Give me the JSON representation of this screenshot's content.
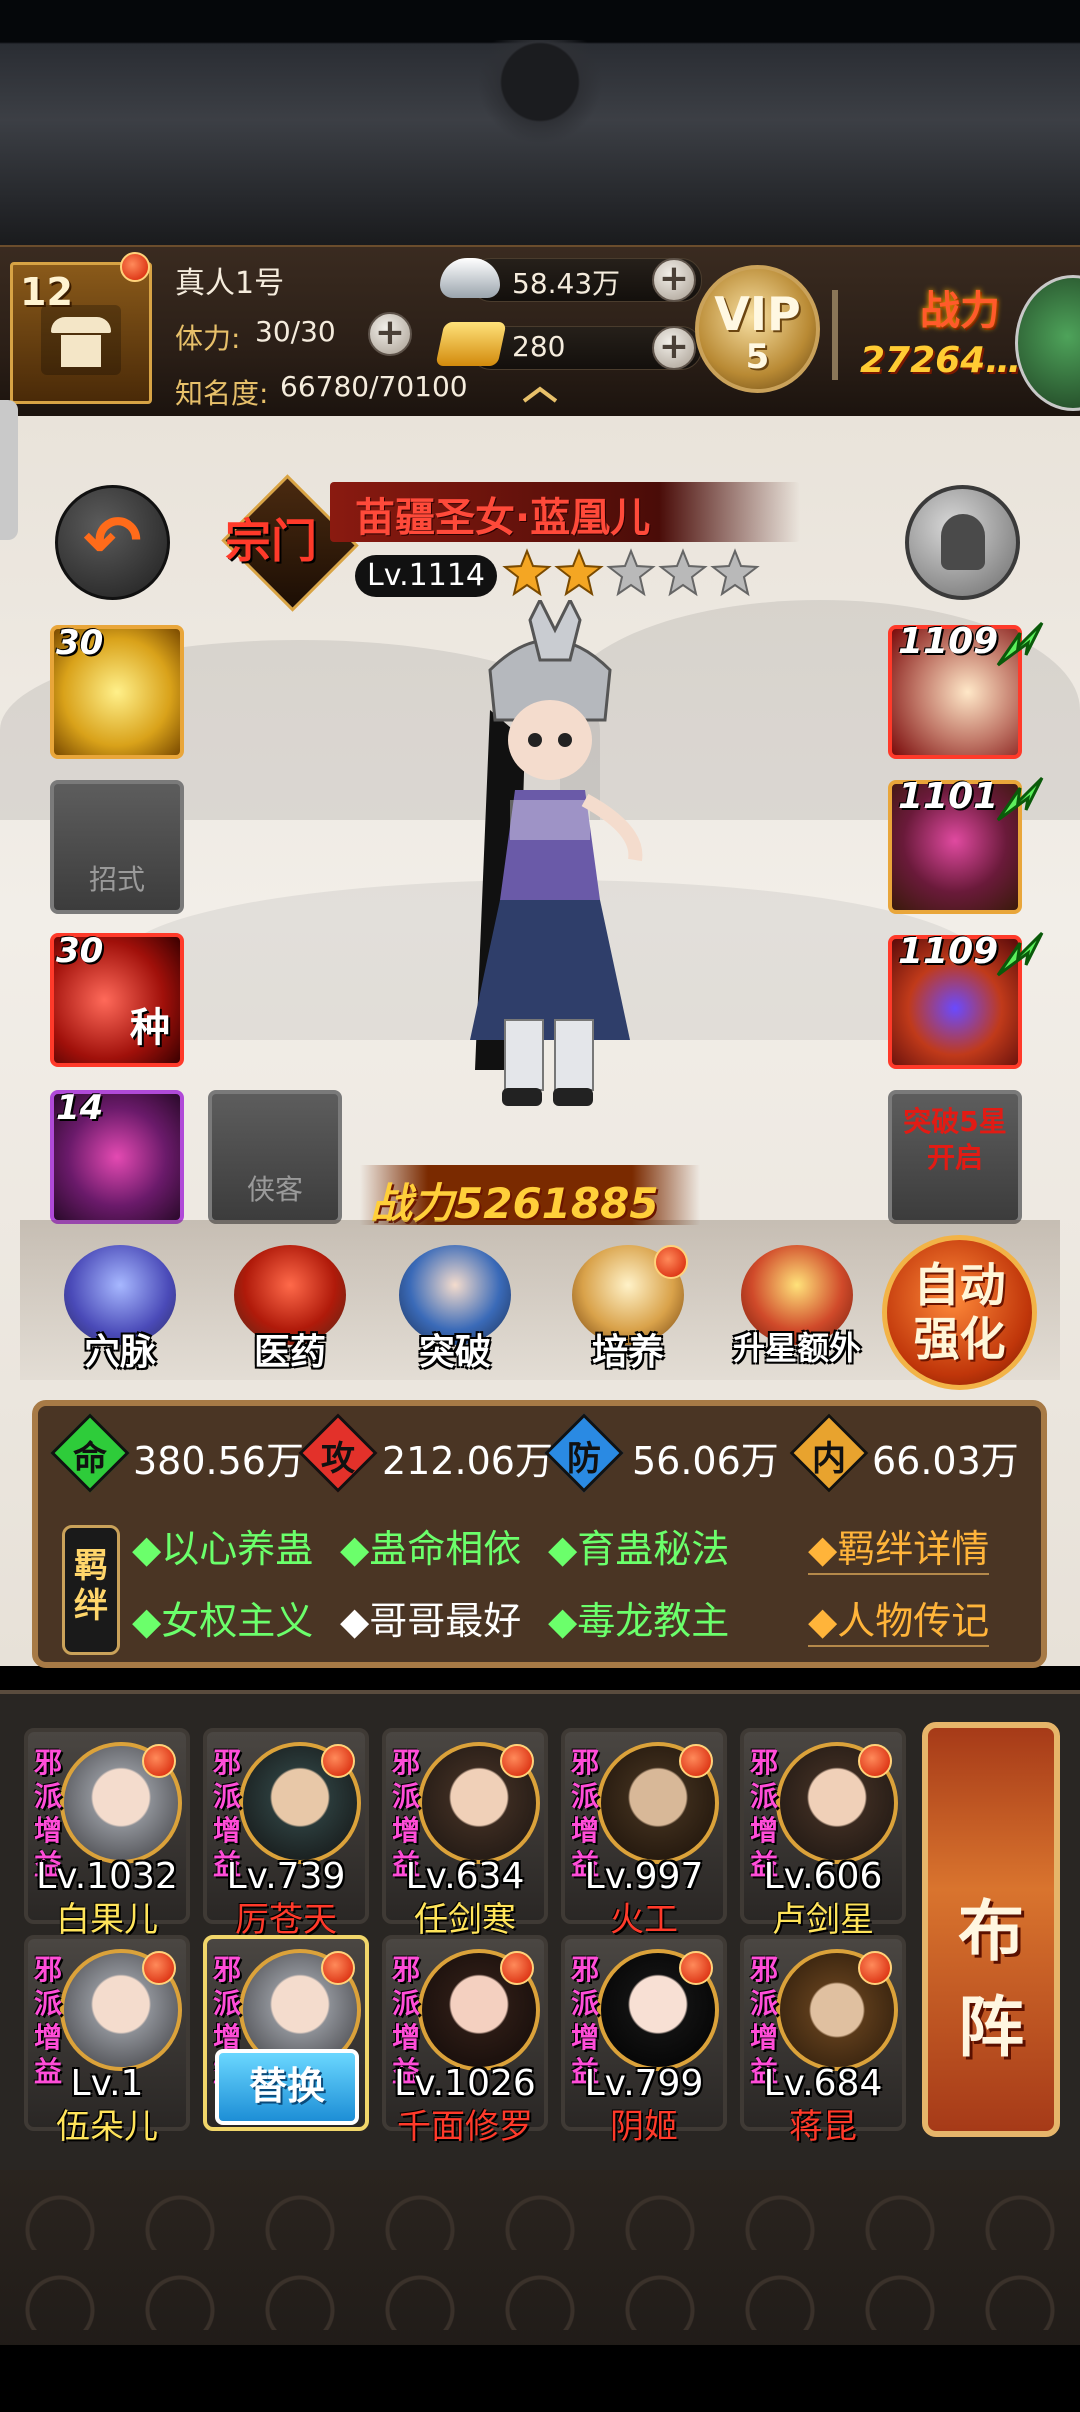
{
  "header": {
    "player_level": "12",
    "player_name": "真人1号",
    "stamina_label": "体力:",
    "stamina_value": "30/30",
    "fame_label": "知名度:",
    "fame_value": "66780/70100",
    "silver": "58.43万",
    "gold": "280",
    "vip_label": "VIP",
    "vip_level": "5",
    "power_label": "战力",
    "power_value": "27264…"
  },
  "hero": {
    "faction": "宗门",
    "name": "苗疆圣女·蓝凰儿",
    "level": "Lv.1114",
    "stars": 2,
    "max_stars": 5,
    "combat_power": "战力5261885"
  },
  "skills": {
    "slot1_level": "30",
    "slot2_label": "招式",
    "slot3_level": "30",
    "slot3_glyph": "种",
    "slot4_level": "14",
    "companion_label": "侠客"
  },
  "equipment": [
    {
      "level": "1109"
    },
    {
      "level": "1101"
    },
    {
      "level": "1109"
    }
  ],
  "breakthrough_label": "突破5星开启",
  "functions": [
    {
      "label": "穴脉"
    },
    {
      "label": "医药"
    },
    {
      "label": "突破"
    },
    {
      "label": "培养"
    },
    {
      "label": "升星额外"
    }
  ],
  "auto_enhance": {
    "line1": "自动",
    "line2": "强化"
  },
  "stats": [
    {
      "char": "命",
      "value": "380.56万",
      "color": "#2ecc3a"
    },
    {
      "char": "攻",
      "value": "212.06万",
      "color": "#e3312a"
    },
    {
      "char": "防",
      "value": "56.06万",
      "color": "#2a8ae3"
    },
    {
      "char": "内",
      "value": "66.03万",
      "color": "#e8a32e"
    }
  ],
  "bonds_tag": "羁绊",
  "bonds": [
    {
      "text": "◆以心养蛊",
      "active": true
    },
    {
      "text": "◆蛊命相依",
      "active": true
    },
    {
      "text": "◆育蛊秘法",
      "active": true
    },
    {
      "text": "◆女权主义",
      "active": true
    },
    {
      "text": "◆哥哥最好",
      "active": false
    },
    {
      "text": "◆毒龙教主",
      "active": true
    }
  ],
  "links": {
    "bond_detail": "◆羁绊详情",
    "biography": "◆人物传记"
  },
  "team_buff_label": "邪派增益",
  "team": [
    {
      "level": "Lv.1032",
      "name": "白果儿",
      "name_color": "yellow"
    },
    {
      "level": "Lv.739",
      "name": "厉苍天",
      "name_color": "red"
    },
    {
      "level": "Lv.634",
      "name": "任剑寒",
      "name_color": "yellow"
    },
    {
      "level": "Lv.997",
      "name": "火工",
      "name_color": "red"
    },
    {
      "level": "Lv.606",
      "name": "卢剑星",
      "name_color": "yellow"
    },
    {
      "level": "Lv.1",
      "name": "伍朵儿",
      "name_color": "yellow"
    },
    {
      "level": "",
      "name": "",
      "name_color": "yellow",
      "replace": "替换"
    },
    {
      "level": "Lv.1026",
      "name": "千面修罗",
      "name_color": "red"
    },
    {
      "level": "Lv.799",
      "name": "阴姬",
      "name_color": "red"
    },
    {
      "level": "Lv.684",
      "name": "蒋昆",
      "name_color": "red"
    }
  ],
  "formation_button": {
    "line1": "布",
    "line2": "阵"
  }
}
